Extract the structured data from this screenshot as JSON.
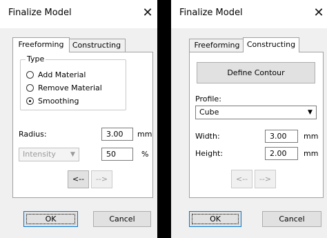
{
  "left_dialog": {
    "title": "Finalize Model",
    "close_glyph": "✕",
    "tabs": [
      "Freeforming",
      "Constructing"
    ],
    "active_tab": "Freeforming",
    "type_group": {
      "legend": "Type",
      "options": [
        "Add Material",
        "Remove Material",
        "Smoothing"
      ],
      "selected": "Smoothing"
    },
    "radius": {
      "label": "Radius:",
      "value": "3.00",
      "unit": "mm"
    },
    "intensity": {
      "selected": "Intensity",
      "value": "50",
      "unit": "%"
    },
    "nav": {
      "prev": "<--",
      "next": "-->"
    },
    "ok_label": "OK",
    "cancel_label": "Cancel"
  },
  "right_dialog": {
    "title": "Finalize Model",
    "close_glyph": "✕",
    "tabs": [
      "Freeforming",
      "Constructing"
    ],
    "active_tab": "Constructing",
    "define_contour_label": "Define Contour",
    "profile": {
      "label": "Profile:",
      "selected": "Cube"
    },
    "width": {
      "label": "Width:",
      "value": "3.00",
      "unit": "mm"
    },
    "height": {
      "label": "Height:",
      "value": "2.00",
      "unit": "mm"
    },
    "nav": {
      "prev": "<--",
      "next": "-->"
    },
    "ok_label": "OK",
    "cancel_label": "Cancel"
  },
  "icons": {
    "close": "close-icon",
    "dropdown": "chevron-down-icon"
  }
}
